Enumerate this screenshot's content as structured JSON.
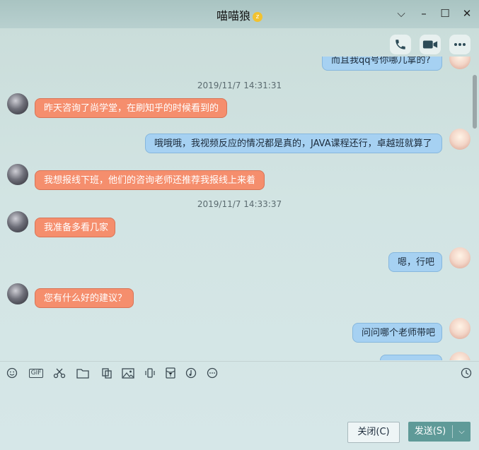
{
  "window": {
    "title": "喵喵狼",
    "badge": "z",
    "minimize_icon": "–",
    "maximize_icon": "☐",
    "close_icon": "✕",
    "collapse_icon": "⌵"
  },
  "messages": [
    {
      "side": "right",
      "text": "而且我qq号你哪儿拿的?"
    },
    {
      "side": "time",
      "text": "2019/11/7 14:31:31"
    },
    {
      "side": "left",
      "text": "昨天咨询了尚学堂，在刷知乎的时候看到的"
    },
    {
      "side": "right",
      "text": "哦哦哦，我视频反应的情况都是真的，JAVA课程还行，卓越班就算了"
    },
    {
      "side": "left",
      "text": "我想报线下班，他们的咨询老师还推荐我报线上来着"
    },
    {
      "side": "time",
      "text": "2019/11/7 14:33:37"
    },
    {
      "side": "left",
      "text": "我准备多看几家"
    },
    {
      "side": "right",
      "text": "嗯，行吧"
    },
    {
      "side": "left",
      "text": "您有什么好的建议？"
    },
    {
      "side": "right",
      "text": "问问哪个老师带吧"
    }
  ],
  "toolbar": {
    "gif_label": "GIF",
    "icons": [
      "emoji-icon",
      "gif-icon",
      "scissors-icon",
      "folder-icon",
      "screenshot-icon",
      "image-icon",
      "shake-icon",
      "red-packet-icon",
      "music-icon",
      "more-icon",
      "history-icon"
    ]
  },
  "buttons": {
    "close_label": "关闭(C)",
    "send_label": "发送(S)",
    "send_dropdown": "⌵"
  },
  "input": {
    "value": ""
  }
}
